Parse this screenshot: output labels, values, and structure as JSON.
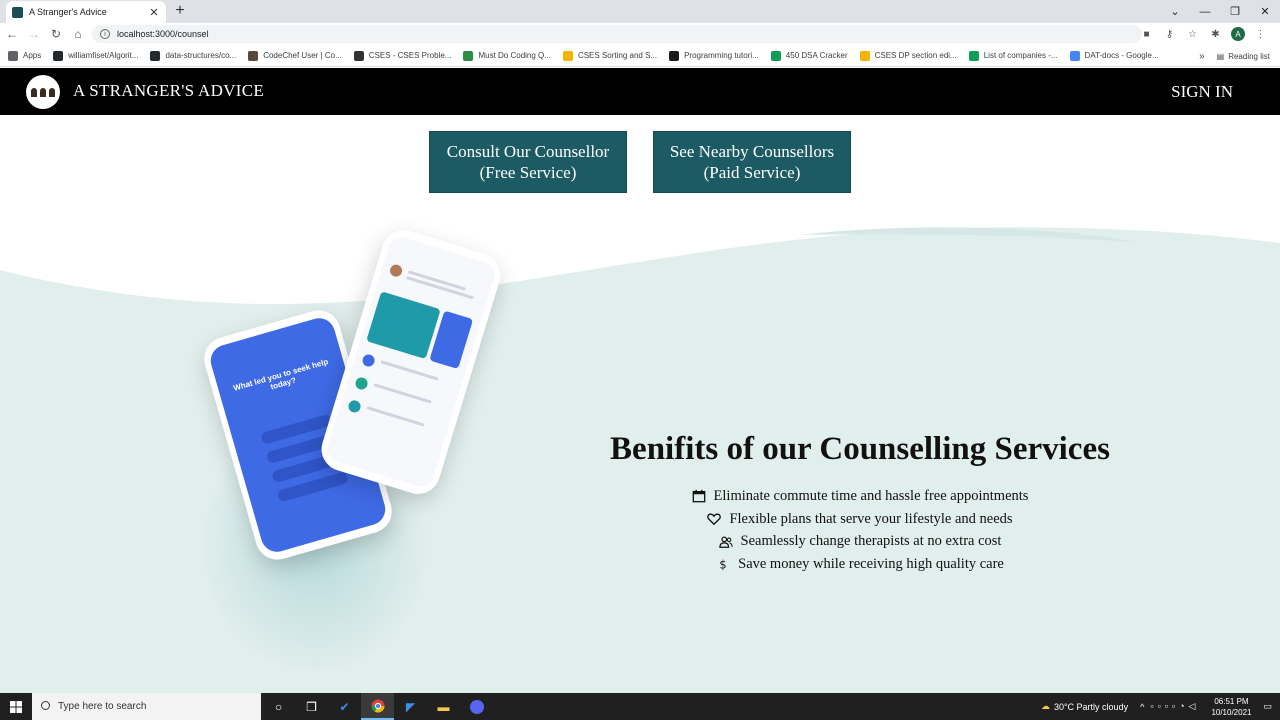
{
  "browser": {
    "tab_title": "A Stranger's Advice",
    "new_tab": "+",
    "url": "localhost:3000/counsel",
    "bookmarks": [
      {
        "label": "Apps",
        "color": "#5f6368"
      },
      {
        "label": "williamfiset/Algorit...",
        "color": "#24292e"
      },
      {
        "label": "data-structures/co...",
        "color": "#24292e"
      },
      {
        "label": "CodeChef User | Co...",
        "color": "#5b4638"
      },
      {
        "label": "CSES - CSES Proble...",
        "color": "#333333"
      },
      {
        "label": "Must Do Coding Q...",
        "color": "#2f8d46"
      },
      {
        "label": "CSES Sorting and S...",
        "color": "#f4b400"
      },
      {
        "label": "Programming tutori...",
        "color": "#1a1a1a"
      },
      {
        "label": "450 DSA Cracker",
        "color": "#0f9d58"
      },
      {
        "label": "CSES DP section edi...",
        "color": "#f4b400"
      },
      {
        "label": "List of companies -...",
        "color": "#0f9d58"
      },
      {
        "label": "DAT-docs - Google...",
        "color": "#4285f4"
      }
    ],
    "bookmarks_overflow": "»",
    "reading_list": "Reading list",
    "profile_initial": "A"
  },
  "site": {
    "brand": "A STRANGER'S ADVICE",
    "sign_in": "SIGN IN",
    "consult_button": [
      "Consult Our Counsellor",
      "(Free Service)"
    ],
    "nearby_button": [
      "See Nearby Counsellors",
      "(Paid Service)"
    ],
    "benefits_title": "Benifits of our Counselling Services",
    "benefits": [
      {
        "icon": "calendar-icon",
        "text": "Eliminate commute time and hassle free appointments"
      },
      {
        "icon": "heart-icon",
        "text": "Flexible plans that serve your lifestyle and needs"
      },
      {
        "icon": "users-icon",
        "text": "Seamlessly change therapists at no extra cost"
      },
      {
        "icon": "dollar-icon",
        "text": "Save money while receiving high quality care"
      }
    ],
    "phone_question": "What led you to seek help today?"
  },
  "taskbar": {
    "search_placeholder": "Type here to search",
    "weather": "30°C  Partly cloudy",
    "time": "06:51 PM",
    "date": "10/10/2021"
  },
  "colors": {
    "button_bg": "#1d5b64",
    "wave_bg": "#e0eeec",
    "nav_bg": "#000000"
  }
}
